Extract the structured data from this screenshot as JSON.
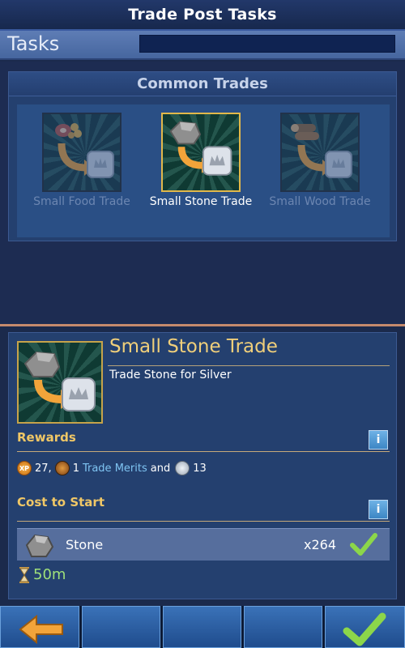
{
  "header": {
    "title": "Trade Post Tasks"
  },
  "tasks_bar": {
    "label": "Tasks"
  },
  "common_trades": {
    "title": "Common Trades",
    "items": [
      {
        "label": "Small Food Trade",
        "state": "locked"
      },
      {
        "label": "Small Stone Trade",
        "state": "selected"
      },
      {
        "label": "Small Wood Trade",
        "state": "locked"
      }
    ]
  },
  "detail": {
    "title": "Small Stone Trade",
    "description": "Trade Stone for Silver",
    "rewards": {
      "title": "Rewards",
      "xp_badge": "XP",
      "xp": "27,",
      "merits_count": "1",
      "merits_label": "Trade Merits",
      "and_text": "and",
      "silver": "13"
    },
    "cost": {
      "title": "Cost to Start",
      "resource": "Stone",
      "amount": "x264",
      "satisfied": true
    },
    "duration": "50m"
  },
  "info_button_label": "i",
  "icons": {
    "back": "back-arrow-icon",
    "confirm": "checkmark-icon",
    "info": "info-icon",
    "xp": "xp-coin-icon",
    "merits": "trade-merits-icon",
    "silver": "silver-coin-icon",
    "stone": "stone-icon",
    "hourglass": "hourglass-icon"
  },
  "colors": {
    "accent_gold": "#f0c766",
    "confirm_green": "#8cd64a",
    "back_orange": "#f2a43a",
    "time_green": "#9fe07a",
    "link_blue": "#7fc4f2"
  }
}
